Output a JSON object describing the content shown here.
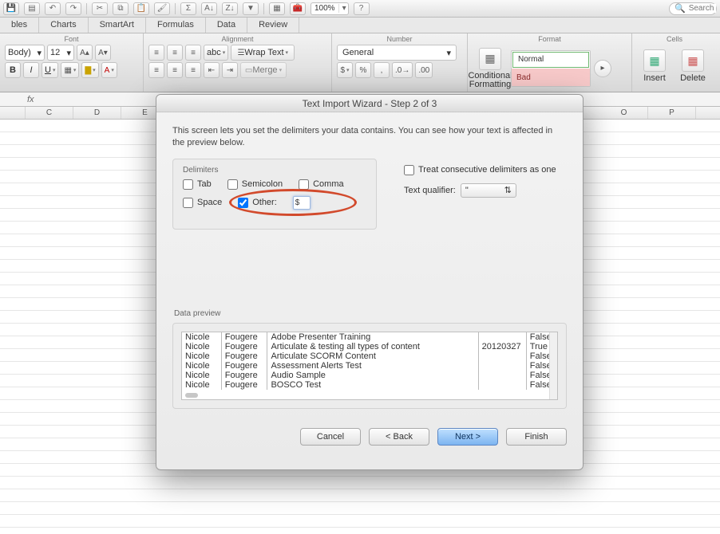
{
  "quickbar": {
    "zoom": "100%",
    "search_placeholder": "Search"
  },
  "tabs": {
    "t1": "bles",
    "t2": "Charts",
    "t3": "SmartArt",
    "t4": "Formulas",
    "t5": "Data",
    "t6": "Review"
  },
  "groups": {
    "font_title": "Font",
    "font_name": "Body)",
    "font_size": "12",
    "align_title": "Alignment",
    "abc_label": "abc",
    "wrap_label": "Wrap Text",
    "merge_label": "Merge",
    "number_title": "Number",
    "number_format": "General",
    "format_title": "Format",
    "cf_label": "Conditional\nFormatting",
    "style_normal": "Normal",
    "style_bad": "Bad",
    "cells_title": "Cells",
    "insert_label": "Insert",
    "delete_label": "Delete"
  },
  "fbar": {
    "fx": "fx"
  },
  "cols": {
    "c1": "C",
    "c2": "D",
    "c3": "E",
    "c12": "O",
    "c13": "P"
  },
  "dialog": {
    "title": "Text Import Wizard - Step 2 of 3",
    "intro": "This screen lets you set the delimiters your data contains.  You can see how your text is affected in the preview below.",
    "delimiters_label": "Delimiters",
    "tab": "Tab",
    "semicolon": "Semicolon",
    "comma": "Comma",
    "space": "Space",
    "other": "Other:",
    "other_value": "$",
    "treat": "Treat consecutive delimiters as one",
    "tq_label": "Text qualifier:",
    "tq_value": "\"",
    "preview_label": "Data preview",
    "rows": [
      {
        "c1": "Nicole",
        "c2": "Fougere",
        "c3": "Adobe Presenter Training",
        "c4": "",
        "c5": "False"
      },
      {
        "c1": "Nicole",
        "c2": "Fougere",
        "c3": "Articulate & testing all types of content",
        "c4": "20120327",
        "c5": "True"
      },
      {
        "c1": "Nicole",
        "c2": "Fougere",
        "c3": "Articulate SCORM Content",
        "c4": "",
        "c5": "False"
      },
      {
        "c1": "Nicole",
        "c2": "Fougere",
        "c3": "Assessment Alerts Test",
        "c4": "",
        "c5": "False"
      },
      {
        "c1": "Nicole",
        "c2": "Fougere",
        "c3": "Audio Sample",
        "c4": "",
        "c5": "False"
      },
      {
        "c1": "Nicole",
        "c2": "Fougere",
        "c3": "BOSCO Test",
        "c4": "",
        "c5": "False"
      }
    ],
    "btn_cancel": "Cancel",
    "btn_back": "< Back",
    "btn_next": "Next >",
    "btn_finish": "Finish"
  }
}
